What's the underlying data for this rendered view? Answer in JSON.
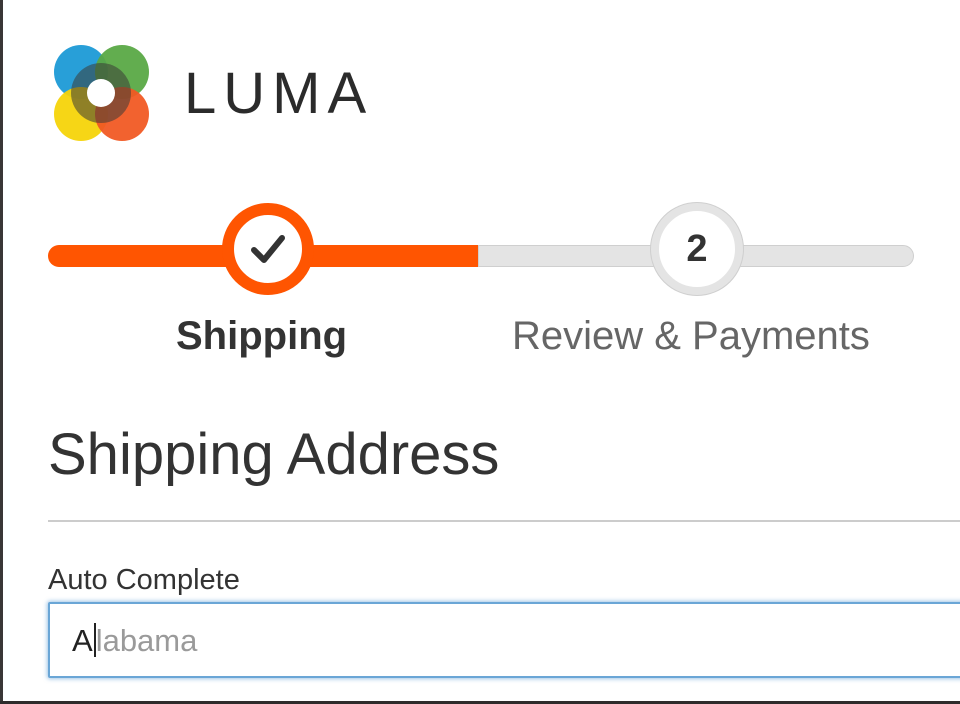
{
  "brand": {
    "name": "LUMA",
    "logo_icon": "luma-logo-icon",
    "colors": {
      "blue": "#1c9ad6",
      "green": "#5aa946",
      "yellow": "#f6d40a",
      "orange": "#f15a24",
      "dark": "#2b2b2b"
    }
  },
  "progress": {
    "accent": "#ff5501",
    "inactive": "#e4e4e4",
    "steps": [
      {
        "label": "Shipping",
        "state": "complete",
        "icon": "checkmark-icon"
      },
      {
        "label": "Review & Payments",
        "number": "2",
        "state": "pending"
      }
    ]
  },
  "section": {
    "title": "Shipping Address"
  },
  "field": {
    "label": "Auto Complete",
    "typed_value": "A",
    "suggestion_remainder": "labama",
    "focus_color": "#6aa6d6"
  }
}
